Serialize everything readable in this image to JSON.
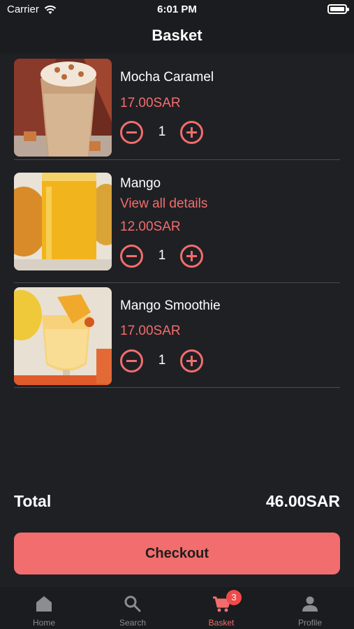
{
  "status": {
    "carrier": "Carrier",
    "time": "6:01 PM"
  },
  "header": {
    "title": "Basket"
  },
  "items": [
    {
      "name": "Mocha Caramel",
      "details": "",
      "price": "17.00SAR",
      "qty": "1"
    },
    {
      "name": "Mango",
      "details": "View all details",
      "price": "12.00SAR",
      "qty": "1"
    },
    {
      "name": "Mango Smoothie",
      "details": "",
      "price": "17.00SAR",
      "qty": "1"
    }
  ],
  "total": {
    "label": "Total",
    "value": "46.00SAR"
  },
  "checkout_label": "Checkout",
  "tabs": [
    {
      "label": "Home",
      "icon": "home-icon"
    },
    {
      "label": "Search",
      "icon": "search-icon"
    },
    {
      "label": "Basket",
      "icon": "cart-icon",
      "badge": "3"
    },
    {
      "label": "Profile",
      "icon": "profile-icon"
    }
  ],
  "colors": {
    "accent": "#f26d6d",
    "background": "#1f2024",
    "badge": "#ee4b4b"
  }
}
